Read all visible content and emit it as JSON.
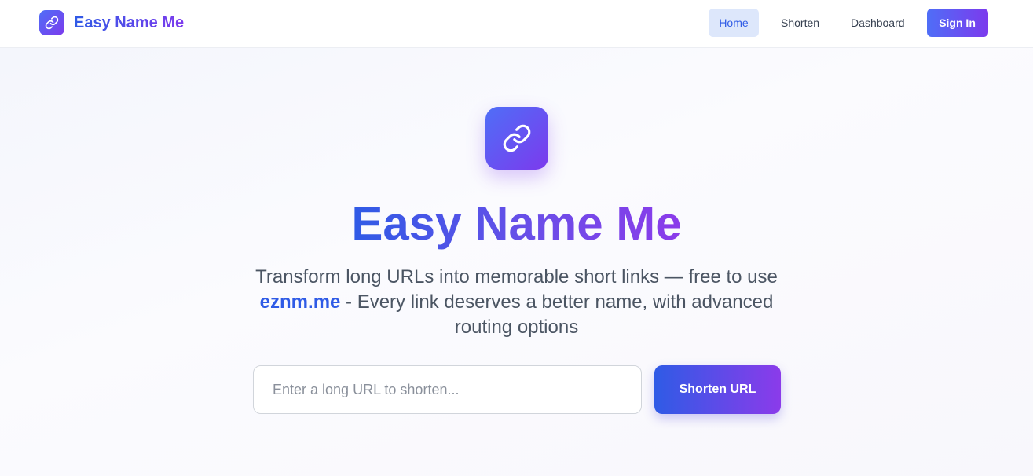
{
  "header": {
    "brand_name": "Easy Name Me",
    "brand_icon": "link-icon",
    "nav": {
      "home": "Home",
      "shorten": "Shorten",
      "dashboard": "Dashboard"
    },
    "sign_in": "Sign In"
  },
  "hero": {
    "icon": "link-icon",
    "title": "Easy Name Me",
    "subtitle_line1": "Transform long URLs into memorable short links — free to use",
    "subtitle_domain": "eznm.me",
    "subtitle_rest": " - Every link deserves a better name, with advanced routing options"
  },
  "form": {
    "placeholder": "Enter a long URL to shorten...",
    "value": "",
    "submit_label": "Shorten URL"
  },
  "colors": {
    "accent_blue": "#2f5be6",
    "accent_purple": "#7c3aed",
    "nav_active_bg": "#dde7fb"
  }
}
